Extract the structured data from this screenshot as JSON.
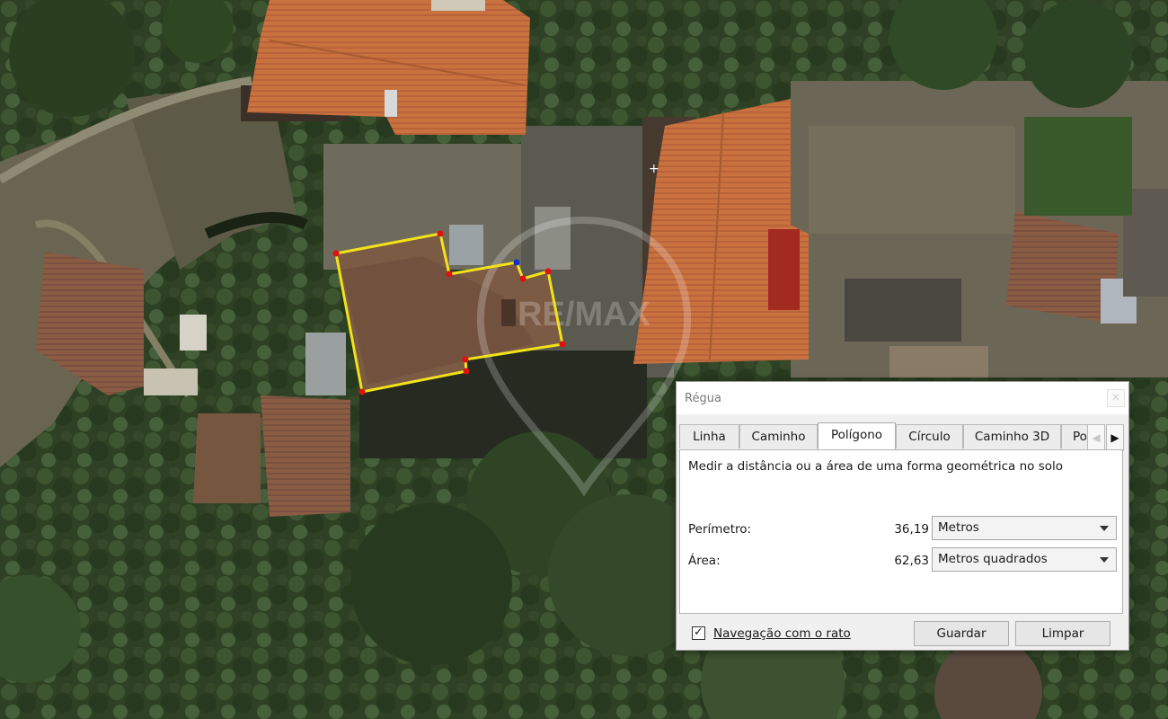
{
  "map": {
    "watermark": "RE/MAX",
    "polygon_color": "#f2e21a",
    "vertex_color": "#e01010",
    "active_vertex_color": "#1030d0"
  },
  "dialog": {
    "title": "Régua",
    "close_icon": "close-icon",
    "tabs": [
      "Linha",
      "Caminho",
      "Polígono",
      "Círculo",
      "Caminho 3D",
      "Po"
    ],
    "active_tab": "Polígono",
    "description": "Medir a distância ou a área de uma forma geométrica no solo",
    "perimeter": {
      "label": "Perímetro:",
      "value": "36,19",
      "unit": "Metros"
    },
    "area": {
      "label": "Área:",
      "value": "62,63",
      "unit": "Metros quadrados"
    },
    "mouse_nav": {
      "label": "Navegação com o rato",
      "checked": true
    },
    "save_label": "Guardar",
    "clear_label": "Limpar"
  }
}
